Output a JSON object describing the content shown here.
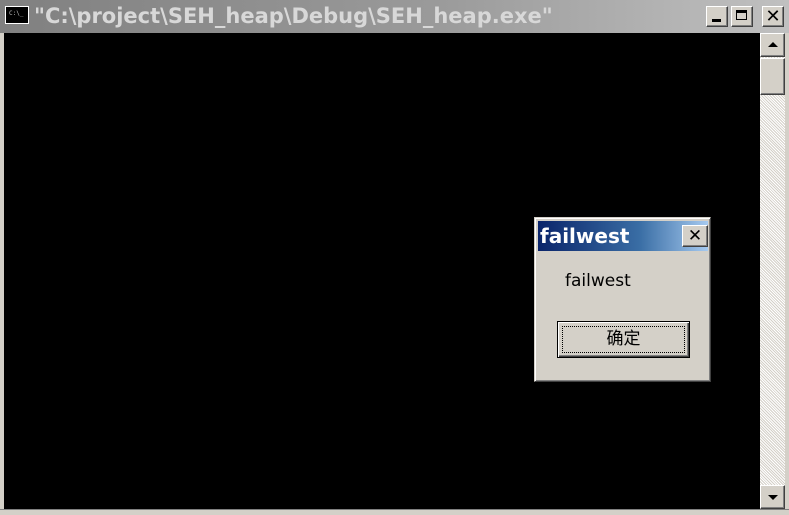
{
  "window": {
    "title": "\"C:\\project\\SEH_heap\\Debug\\SEH_heap.exe\"",
    "icon_text": "C:\\_",
    "icon": "console-app-icon",
    "buttons": {
      "minimize": "minimize-icon",
      "maximize": "maximize-icon",
      "close_label": "✕"
    }
  },
  "console": {
    "background": "#000000"
  },
  "scrollbar": {
    "up": "up-arrow-icon",
    "down": "down-arrow-icon"
  },
  "messagebox": {
    "title": "failwest",
    "close_label": "✕",
    "message": "failwest",
    "ok_label": "确定"
  },
  "colors": {
    "dialog_titlebar_start": "#0a246a",
    "dialog_titlebar_end": "#a6caf0",
    "inactive_titlebar": "#9a9a9a"
  }
}
